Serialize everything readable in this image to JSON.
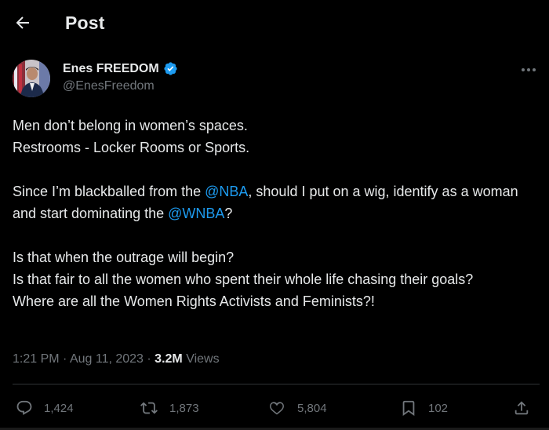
{
  "header": {
    "title": "Post"
  },
  "author": {
    "name": "Enes FREEDOM",
    "handle": "@EnesFreedom",
    "verified": true
  },
  "tweet": {
    "line1": "Men don’t belong in women’s spaces.",
    "line2": "Restrooms - Locker Rooms or Sports.",
    "p2_part1": "Since I’m blackballed from the ",
    "mention_nba": "@NBA",
    "p2_part2": ", should I put on a wig, identify as a woman and start dominating the ",
    "mention_wnba": "@WNBA",
    "p2_part3": "?",
    "line3": "Is that when the outrage will begin?",
    "line4": "Is that fair to all the women who spent their whole life chasing their goals?",
    "line5": "Where are all the Women Rights Activists and Feminists?!"
  },
  "meta": {
    "time": "1:21 PM",
    "separator": " · ",
    "date": "Aug 11, 2023",
    "views_count": "3.2M",
    "views_label": "Views"
  },
  "actions": {
    "replies": "1,424",
    "reposts": "1,873",
    "likes": "5,804",
    "bookmarks": "102"
  },
  "colors": {
    "background": "#000000",
    "text": "#e7e9ea",
    "secondary": "#71767b",
    "link": "#1d9bf0",
    "verified": "#1d9bf0",
    "divider": "#2f3336"
  },
  "icons": {
    "back": "arrow-left-icon",
    "verified": "verified-badge-icon",
    "more": "more-horizontal-icon",
    "reply": "reply-icon",
    "repost": "repost-icon",
    "like": "heart-icon",
    "bookmark": "bookmark-icon",
    "share": "share-icon"
  }
}
